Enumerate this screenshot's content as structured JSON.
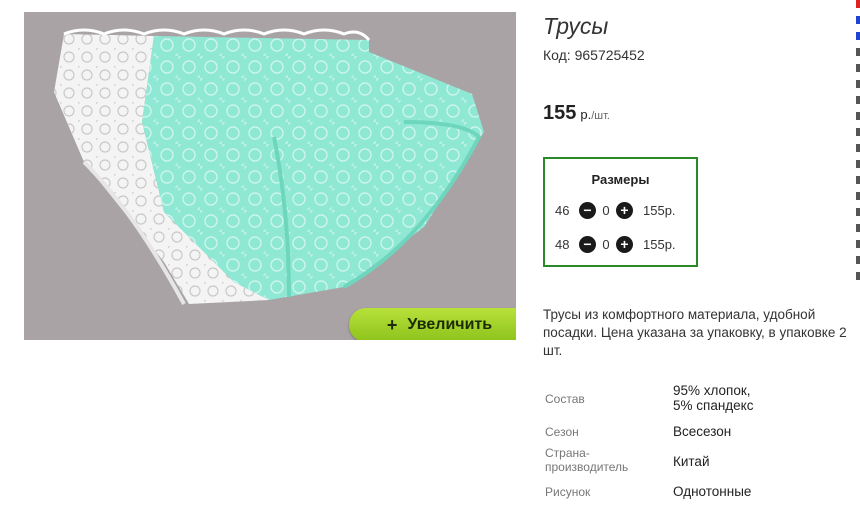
{
  "product": {
    "title": "Трусы",
    "code_label": "Код: 965725452",
    "price_value": "155",
    "price_currency": "р.",
    "price_unit": "/шт."
  },
  "photo": {
    "zoom_button_label": "Увеличить",
    "zoom_button_icon": "plus-icon"
  },
  "sizes": {
    "title": "Размеры",
    "rows": [
      {
        "size": "46",
        "qty": "0",
        "price": "155р."
      },
      {
        "size": "48",
        "qty": "0",
        "price": "155р."
      }
    ]
  },
  "description": "Трусы из комфортного материала, удобной посадки. Цена указана за упаковку, в упаковке 2 шт.",
  "attributes": [
    {
      "key": "Состав",
      "value_lines": [
        "95% хлопок,",
        "5% спандекс"
      ]
    },
    {
      "key": "Сезон",
      "value_lines": [
        "Всесезон"
      ]
    },
    {
      "key_lines": [
        "Страна-",
        "производитель"
      ],
      "value_lines": [
        "Китай"
      ]
    },
    {
      "key": "Рисунок",
      "value_lines": [
        "Однотонные"
      ]
    }
  ],
  "colors": {
    "size_box_border": "#2a8a2a",
    "zoom_button": "#9fd12a",
    "photo_background": "#a9a3a6",
    "mint_fabric": "#8ee8d4",
    "white_fabric": "#f4f4f4"
  }
}
